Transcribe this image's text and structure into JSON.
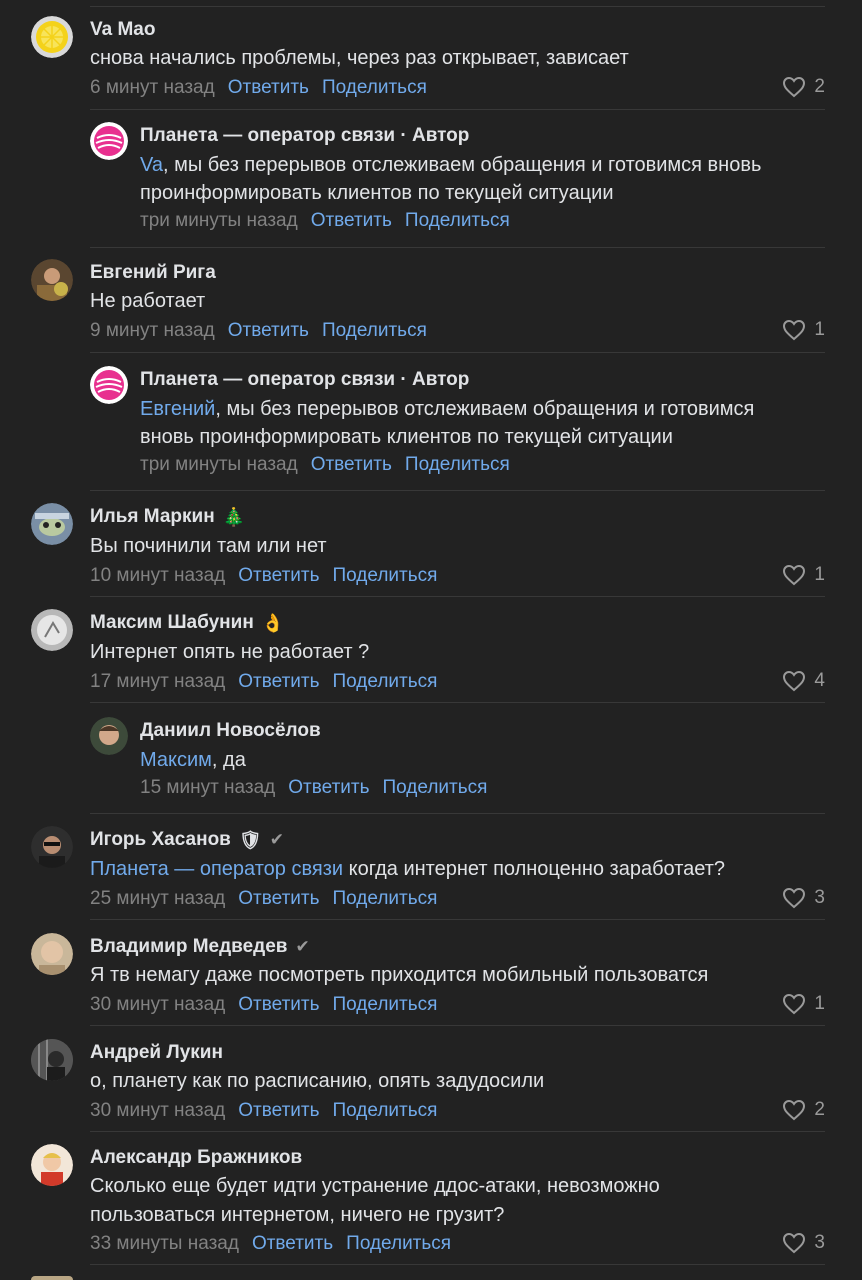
{
  "actions": {
    "reply": "Ответить",
    "share": "Поделиться"
  },
  "comments": [
    {
      "author": "Va Mao",
      "text": "снова начались проблемы, через раз открывает, зависает",
      "time": "6 минут назад",
      "likes": "2",
      "reply": {
        "author": "Планета — оператор связи · Автор",
        "mention": "Va",
        "text_line1": ", мы без перерывов отслеживаем обращения и готовимся вновь",
        "text_line2": "проинформировать клиентов по текущей ситуации",
        "time": "три минуты назад"
      }
    },
    {
      "author": "Евгений Рига",
      "text": "Не работает",
      "time": "9 минут назад",
      "likes": "1",
      "reply": {
        "author": "Планета — оператор связи · Автор",
        "mention": "Евгений",
        "text_line1": ", мы без перерывов отслеживаем обращения и готовимся",
        "text_line2": "вновь проинформировать клиентов по текущей ситуации",
        "time": "три минуты назад"
      }
    },
    {
      "author": "Илья Маркин",
      "badge": "🎄",
      "text": "Вы починили там или нет",
      "time": "10 минут назад",
      "likes": "1"
    },
    {
      "author": "Максим Шабунин",
      "badge": "👌",
      "text": "Интернет опять не работает ?",
      "time": "17 минут назад",
      "likes": "4",
      "reply": {
        "author": "Даниил Новосёлов",
        "mention": "Максим",
        "text_line1": ", да",
        "time": "15 минут назад"
      }
    },
    {
      "author": "Игорь Хасанов",
      "badge": "🛡",
      "mention": "Планета — оператор связи",
      "text": " когда интернет полноценно заработает?",
      "time": "25 минут назад",
      "likes": "3"
    },
    {
      "author": "Владимир Медведев",
      "text": "Я тв немагу даже посмотреть приходится мобильный пользоватся",
      "time": "30 минут назад",
      "likes": "1"
    },
    {
      "author": "Андрей Лукин",
      "text": "о, планету как по расписанию, опять задудосили",
      "time": "30 минут назад",
      "likes": "2"
    },
    {
      "author": "Александр Бражников",
      "text_line1": "Сколько еще будет идти устранение ддос-атаки, невозможно",
      "text_line2": "пользоваться интернетом, ничего не грузит?",
      "time": "33 минуты назад",
      "likes": "3"
    }
  ],
  "colors": {
    "background": "#222222",
    "text": "#e1e3e6",
    "link": "#71aaeb",
    "meta": "#828282",
    "divider": "#383838"
  },
  "icons": {
    "like": "heart-outline-icon",
    "verified": "checkmark-icon"
  }
}
